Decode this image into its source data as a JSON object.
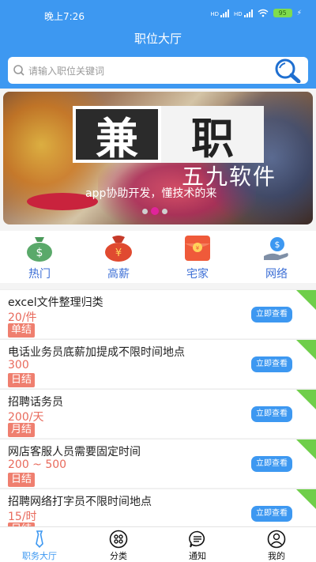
{
  "status": {
    "time": "晚上7:26",
    "signal1": "HD",
    "signal2": "HD",
    "battery": "95"
  },
  "header": {
    "title": "职位大厅"
  },
  "search": {
    "placeholder": "请输入职位关键词"
  },
  "banner": {
    "char1": "兼",
    "char2": "职",
    "subtitle": "五九软件",
    "tagline": "app协助开发，懂技术的来"
  },
  "categories": [
    {
      "label": "热门",
      "icon": "money-bag-icon"
    },
    {
      "label": "高薪",
      "icon": "yuan-bag-icon"
    },
    {
      "label": "宅家",
      "icon": "red-envelope-icon"
    },
    {
      "label": "网络",
      "icon": "hand-coin-icon"
    }
  ],
  "jobs": [
    {
      "title": "excel文件整理归类",
      "pay": "20/件",
      "type": "单结",
      "button": "立即查看"
    },
    {
      "title": "电话业务员底薪加提成不限时间地点",
      "pay": "300",
      "type": "日结",
      "button": "立即查看"
    },
    {
      "title": "招聘话务员",
      "pay": "200/天",
      "type": "月结",
      "button": "立即查看"
    },
    {
      "title": "网店客服人员需要固定时间",
      "pay": "200 ~ 500",
      "type": "日结",
      "button": "立即查看"
    },
    {
      "title": "招聘网络打字员不限时间地点",
      "pay": "15/时",
      "type": "日结",
      "button": "立即查看"
    }
  ],
  "tabs": [
    {
      "label": "职务大厅",
      "active": true
    },
    {
      "label": "分类"
    },
    {
      "label": "通知"
    },
    {
      "label": "我的"
    }
  ],
  "colors": {
    "primary": "#3d98f1",
    "pay": "#e86a5c",
    "tag": "#ef7f6f",
    "ribbon": "#6fce4a"
  }
}
